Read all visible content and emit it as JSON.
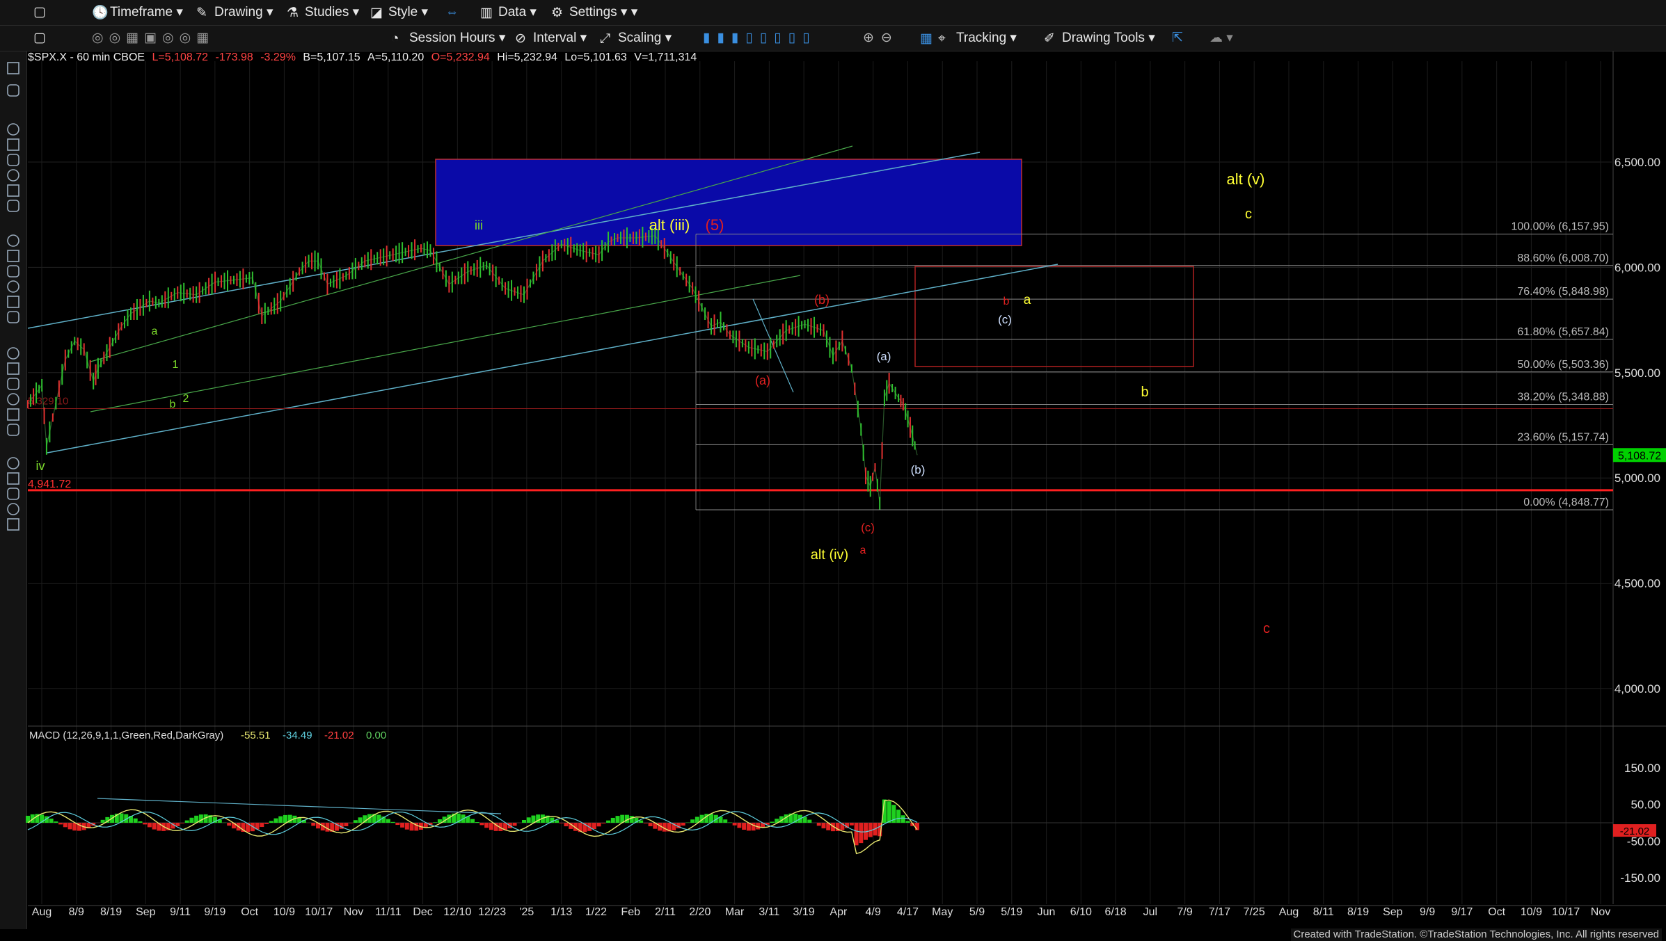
{
  "toolbar1": {
    "timeframe": "Timeframe",
    "drawing": "Drawing",
    "studies": "Studies",
    "style": "Style",
    "data": "Data",
    "settings": "Settings"
  },
  "toolbar2": {
    "session": "Session Hours",
    "interval": "Interval",
    "scaling": "Scaling",
    "tracking": "Tracking",
    "drawing_tools": "Drawing Tools"
  },
  "header": {
    "symbol": "$SPX.X - 60 min CBOE",
    "last": "L=5,108.72",
    "change": "-173.98",
    "pct": "-3.29%",
    "bid": "B=5,107.15",
    "ask": "A=5,110.20",
    "open": "O=5,232.94",
    "high": "Hi=5,232.94",
    "low": "Lo=5,101.63",
    "vol": "V=1,711,314"
  },
  "colors": {
    "up": "#2fbf2f",
    "down": "#e03030",
    "bg": "#000000",
    "blue_box": "#0a0aa8",
    "red_line": "#ff2020",
    "wave_yellow": "#ffff33",
    "wave_red": "#e02020",
    "wave_green": "#7ddc2b"
  },
  "chart_data": {
    "type": "line",
    "title": "$SPX.X - 60 min",
    "xlabel": "",
    "ylabel": "",
    "x": [
      "Aug",
      "8/9",
      "8/19",
      "Sep",
      "9/11",
      "9/19",
      "Oct",
      "10/9",
      "10/17",
      "Nov",
      "11/11",
      "Dec",
      "12/10",
      "12/23",
      "'25",
      "1/13",
      "1/22",
      "Feb",
      "2/11",
      "2/20",
      "Mar",
      "3/11",
      "3/19",
      "Apr",
      "4/9",
      "4/17",
      "May",
      "5/9",
      "5/19",
      "Jun",
      "6/10",
      "6/18",
      "Jul",
      "7/9",
      "7/17",
      "7/25",
      "Aug",
      "8/11",
      "8/19",
      "Sep",
      "9/9",
      "9/17",
      "Oct",
      "10/9",
      "10/17",
      "Nov"
    ],
    "y_ticks": [
      "6,500.00",
      "6,000.00",
      "5,500.00",
      "5,000.00",
      "4,500.00",
      "4,000.00"
    ],
    "ylim": [
      3700,
      6800
    ],
    "series": [
      {
        "values": [
          [
            0,
            5350
          ],
          [
            3,
            5440
          ],
          [
            4,
            5150
          ],
          [
            8,
            5560
          ],
          [
            10,
            5650
          ],
          [
            12,
            5610
          ],
          [
            14,
            5460
          ],
          [
            15,
            5520
          ],
          [
            20,
            5720
          ],
          [
            22,
            5780
          ],
          [
            24,
            5810
          ],
          [
            26,
            5840
          ],
          [
            28,
            5830
          ],
          [
            32,
            5880
          ],
          [
            36,
            5870
          ],
          [
            40,
            5930
          ],
          [
            44,
            5940
          ],
          [
            48,
            5950
          ],
          [
            50,
            5770
          ],
          [
            54,
            5840
          ],
          [
            58,
            5980
          ],
          [
            60,
            6030
          ],
          [
            62,
            6030
          ],
          [
            64,
            5920
          ],
          [
            68,
            5960
          ],
          [
            72,
            6030
          ],
          [
            76,
            6050
          ],
          [
            80,
            6070
          ],
          [
            84,
            6090
          ],
          [
            86,
            6080
          ],
          [
            90,
            5920
          ],
          [
            94,
            5980
          ],
          [
            98,
            6010
          ],
          [
            102,
            5900
          ],
          [
            106,
            5870
          ],
          [
            110,
            6030
          ],
          [
            114,
            6110
          ],
          [
            118,
            6080
          ],
          [
            122,
            6060
          ],
          [
            124,
            6120
          ],
          [
            126,
            6140
          ],
          [
            130,
            6140
          ],
          [
            134,
            6150
          ],
          [
            136,
            6090
          ],
          [
            140,
            5960
          ],
          [
            142,
            5900
          ],
          [
            146,
            5720
          ],
          [
            148,
            5740
          ],
          [
            150,
            5680
          ],
          [
            154,
            5620
          ],
          [
            158,
            5600
          ],
          [
            162,
            5700
          ],
          [
            166,
            5730
          ],
          [
            170,
            5700
          ],
          [
            172,
            5580
          ],
          [
            174,
            5650
          ],
          [
            176,
            5520
          ],
          [
            178,
            5230
          ],
          [
            179,
            5010
          ],
          [
            180,
            4960
          ],
          [
            181,
            5050
          ],
          [
            182,
            4880
          ],
          [
            183,
            5380
          ],
          [
            184,
            5450
          ],
          [
            186,
            5380
          ],
          [
            187,
            5350
          ],
          [
            188,
            5280
          ],
          [
            189,
            5200
          ],
          [
            190,
            5108.72
          ]
        ]
      }
    ],
    "fibonacci": [
      {
        "label": "100.00% (6,157.95)",
        "value": 6157.95
      },
      {
        "label": "88.60% (6,008.70)",
        "value": 6008.7
      },
      {
        "label": "76.40% (5,848.98)",
        "value": 5848.98
      },
      {
        "label": "61.80% (5,657.84)",
        "value": 5657.84
      },
      {
        "label": "50.00% (5,503.36)",
        "value": 5503.36
      },
      {
        "label": "38.20% (5,348.88)",
        "value": 5348.88
      },
      {
        "label": "23.60% (5,157.74)",
        "value": 5157.74
      },
      {
        "label": "0.00% (4,848.77)",
        "value": 4848.77
      }
    ],
    "last_price": "5,108.72",
    "support_line": {
      "label": "4,941.72",
      "value": 4941.72
    },
    "resistance_line_label": "5,329.10",
    "waves": [
      {
        "text": "iv",
        "color": "#7ddc2b"
      },
      {
        "text": "a",
        "color": "#7ddc2b"
      },
      {
        "text": "1",
        "color": "#7ddc2b"
      },
      {
        "text": "2",
        "color": "#7ddc2b"
      },
      {
        "text": "b",
        "color": "#7ddc2b"
      },
      {
        "text": "iii",
        "color": "#7ddc2b"
      },
      {
        "text": "alt (iii)",
        "color": "#ffff33"
      },
      {
        "text": "(5)",
        "color": "#e02020"
      },
      {
        "text": "(a)",
        "color": "#e02020"
      },
      {
        "text": "(b)",
        "color": "#e02020"
      },
      {
        "text": "(c)",
        "color": "#e02020"
      },
      {
        "text": "a",
        "color": "#e02020"
      },
      {
        "text": "alt (iv)",
        "color": "#ffff33"
      },
      {
        "text": "(a)",
        "color": "#cfe0ff"
      },
      {
        "text": "(b)",
        "color": "#cfe0ff"
      },
      {
        "text": "(c)",
        "color": "#cfe0ff"
      },
      {
        "text": "b",
        "color": "#e02020"
      },
      {
        "text": "a",
        "color": "#ffff33"
      },
      {
        "text": "b",
        "color": "#ffff33"
      },
      {
        "text": "c",
        "color": "#ffff33"
      },
      {
        "text": "alt (v)",
        "color": "#ffff33"
      },
      {
        "text": "c",
        "color": "#e02020"
      }
    ],
    "macd": {
      "label": "MACD (12,26,9,1,1,Green,Red,DarkGray)",
      "values": [
        "-55.51",
        "-34.49",
        "-21.02",
        "0.00"
      ],
      "y_ticks": [
        "150.00",
        "50.00",
        "-50.00",
        "-150.00"
      ],
      "last": "-21.02"
    }
  },
  "footer": {
    "credit": "Created with TradeStation. ©TradeStation Technologies, Inc. All rights reserved"
  }
}
